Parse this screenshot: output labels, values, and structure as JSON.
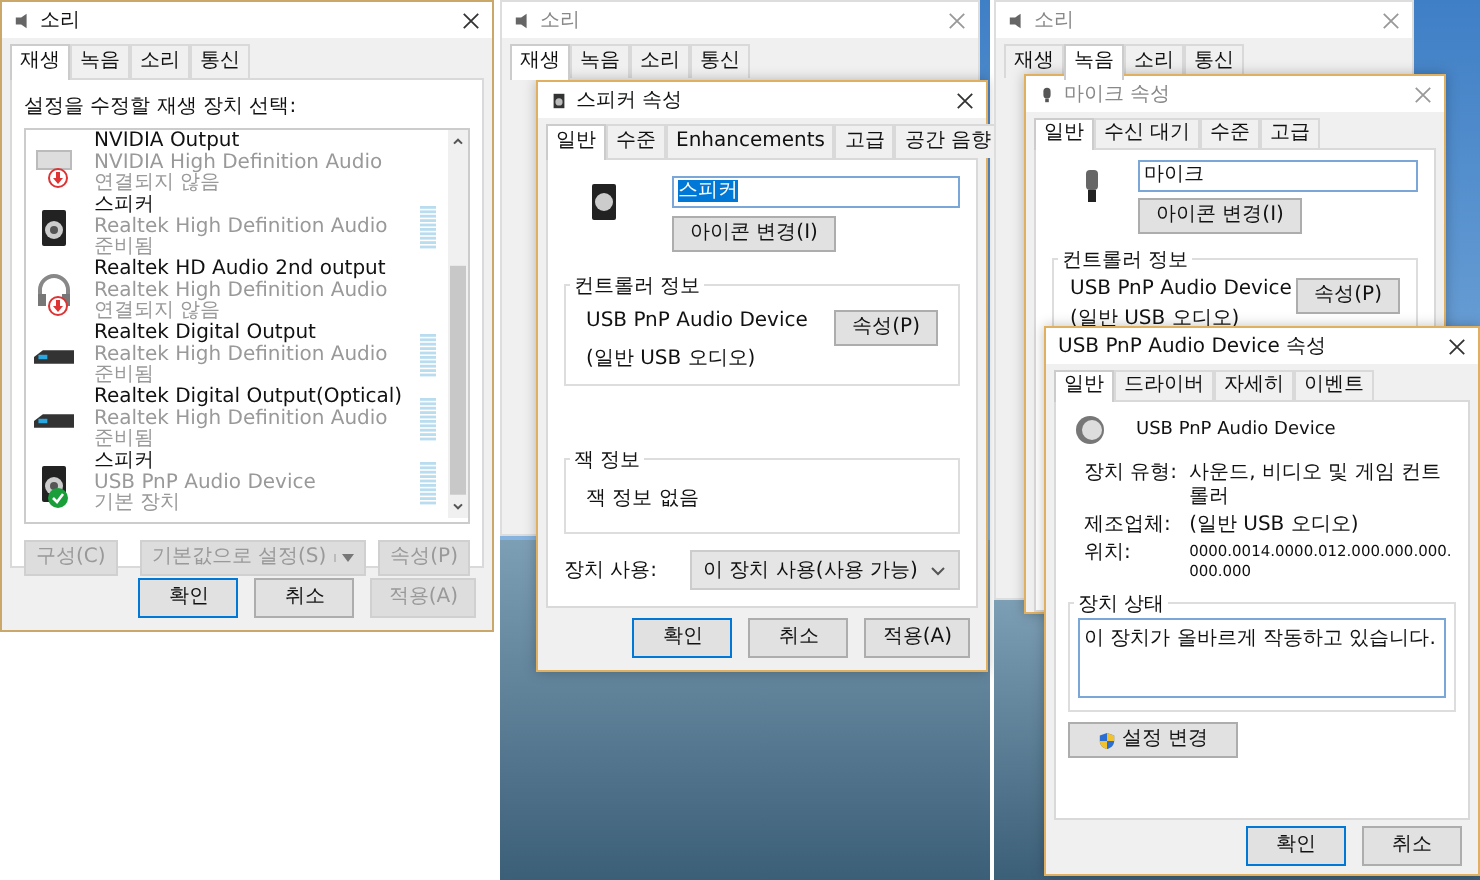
{
  "left": {
    "title": "소리",
    "tabs": [
      {
        "label": "재생",
        "selected": true
      },
      {
        "label": "녹음",
        "selected": false
      },
      {
        "label": "소리",
        "selected": false
      },
      {
        "label": "통신",
        "selected": false
      }
    ],
    "instruction": "설정을 수정할 재생 장치 선택:",
    "devices": [
      {
        "name": "NVIDIA Output",
        "driver": "NVIDIA High Definition Audio",
        "status": "연결되지 않음",
        "kind": "monitor",
        "connected": false,
        "default": false,
        "meter": false
      },
      {
        "name": "스피커",
        "driver": "Realtek High Definition Audio",
        "status": "준비됨",
        "kind": "speaker",
        "connected": true,
        "default": false,
        "meter": true
      },
      {
        "name": "Realtek HD Audio 2nd output",
        "driver": "Realtek High Definition Audio",
        "status": "연결되지 않음",
        "kind": "headphones",
        "connected": false,
        "default": false,
        "meter": false
      },
      {
        "name": "Realtek Digital Output",
        "driver": "Realtek High Definition Audio",
        "status": "준비됨",
        "kind": "digital",
        "connected": true,
        "default": false,
        "meter": true
      },
      {
        "name": "Realtek Digital Output(Optical)",
        "driver": "Realtek High Definition Audio",
        "status": "준비됨",
        "kind": "digital",
        "connected": true,
        "default": false,
        "meter": true
      },
      {
        "name": "스피커",
        "driver": "USB PnP Audio Device",
        "status": "기본 장치",
        "kind": "speaker",
        "connected": true,
        "default": true,
        "meter": true
      }
    ],
    "actions": [
      {
        "label": "구성(C)",
        "disabled": true,
        "kind": "plain"
      },
      {
        "label": "기본값으로 설정(S)",
        "disabled": true,
        "kind": "split"
      },
      {
        "label": "속성(P)",
        "disabled": true,
        "kind": "plain"
      }
    ],
    "footer": [
      {
        "label": "확인",
        "disabled": false,
        "default": true
      },
      {
        "label": "취소",
        "disabled": false,
        "default": false
      },
      {
        "label": "적용(A)",
        "disabled": true,
        "default": false
      }
    ]
  },
  "middle": {
    "background_window": {
      "title": "소리",
      "tabs": [
        {
          "label": "재생",
          "selected": true
        },
        {
          "label": "녹음",
          "selected": false
        },
        {
          "label": "소리",
          "selected": false
        },
        {
          "label": "통신",
          "selected": false
        }
      ]
    },
    "dialog": {
      "title": "스피커 속성",
      "tabs": [
        {
          "label": "일반",
          "selected": true
        },
        {
          "label": "수준",
          "selected": false
        },
        {
          "label": "Enhancements",
          "selected": false
        },
        {
          "label": "고급",
          "selected": false
        },
        {
          "label": "공간 음향",
          "selected": false
        }
      ],
      "name_value": "스피커",
      "name_selected": true,
      "change_icon_button": "아이콘 변경(I)",
      "controller": {
        "title": "컨트롤러 정보",
        "device": "USB PnP Audio Device",
        "vendor": "(일반 USB 오디오)",
        "button": "속성(P)"
      },
      "jack": {
        "title": "잭 정보",
        "text": "잭 정보 없음"
      },
      "usage": {
        "label": "장치 사용:",
        "value": "이 장치 사용(사용 가능)"
      },
      "footer": [
        {
          "label": "확인",
          "disabled": false,
          "default": true
        },
        {
          "label": "취소",
          "disabled": false,
          "default": false
        },
        {
          "label": "적용(A)",
          "disabled": false,
          "default": false
        }
      ]
    }
  },
  "right": {
    "background_window": {
      "title": "소리",
      "tabs": [
        {
          "label": "재생",
          "selected": false
        },
        {
          "label": "녹음",
          "selected": true
        },
        {
          "label": "소리",
          "selected": false
        },
        {
          "label": "통신",
          "selected": false
        }
      ]
    },
    "mic_dialog": {
      "title": "마이크 속성",
      "tabs": [
        {
          "label": "일반",
          "selected": true
        },
        {
          "label": "수신 대기",
          "selected": false
        },
        {
          "label": "수준",
          "selected": false
        },
        {
          "label": "고급",
          "selected": false
        }
      ],
      "name_value": "마이크",
      "name_selected": false,
      "change_icon_button": "아이콘 변경(I)",
      "controller": {
        "title": "컨트롤러 정보",
        "device": "USB PnP Audio Device",
        "vendor": "(일반 USB 오디오)",
        "button": "속성(P)"
      }
    },
    "usb_dialog": {
      "title": "USB PnP Audio Device 속성",
      "tabs": [
        {
          "label": "일반",
          "selected": true
        },
        {
          "label": "드라이버",
          "selected": false
        },
        {
          "label": "자세히",
          "selected": false
        },
        {
          "label": "이벤트",
          "selected": false
        }
      ],
      "device_name": "USB PnP Audio Device",
      "properties": [
        {
          "label": "장치 유형:",
          "value": "사운드, 비디오 및 게임 컨트롤러"
        },
        {
          "label": "제조업체:",
          "value": "(일반 USB 오디오)"
        },
        {
          "label": "위치:",
          "value": "0000.0014.0000.012.000.000.000.000.000"
        }
      ],
      "status": {
        "title": "장치 상태",
        "text": "이 장치가 올바르게 작동하고 있습니다."
      },
      "settings_button": "설정 변경",
      "footer": [
        {
          "label": "확인",
          "disabled": false,
          "default": true
        },
        {
          "label": "취소",
          "disabled": false,
          "default": false
        }
      ]
    }
  }
}
